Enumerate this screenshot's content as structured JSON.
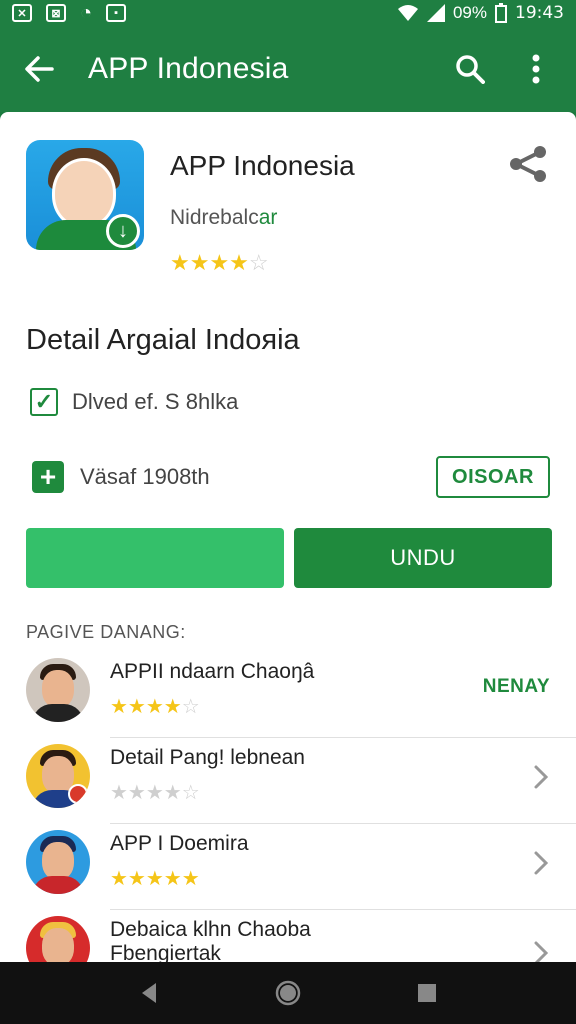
{
  "status_bar": {
    "battery": "09%",
    "time": "19:43"
  },
  "app_bar": {
    "title": "APP Indonesia"
  },
  "app": {
    "name": "APP Indonesia",
    "developer_prefix": "Nidrebalc",
    "developer_suffix": "ar",
    "rating": 3.5,
    "stars": "★★★★☆"
  },
  "detail": {
    "title": "Detail Argaial Indoяia",
    "checkbox_label": "Dlved ef. S 8hlka",
    "checkbox_checked": true,
    "version_label": "Väsaf 1908th",
    "outline_button": "OISOAR"
  },
  "buttons": {
    "primary_label": "UNDU"
  },
  "section": {
    "title": "PAGIVE DANANG:"
  },
  "list": [
    {
      "title": "APPII ndaarn Chaoŋâ",
      "rating": 4,
      "action": "NENAY"
    },
    {
      "title": "Detail Pang! lebnean",
      "rating": 4
    },
    {
      "title": "APP I Doemira",
      "rating": 4.5
    },
    {
      "title": "Debaica klhn Chaoba",
      "subtitle": "Fbengiertak"
    }
  ],
  "colors": {
    "primary": "#1f8a3d",
    "accent_light": "#34c06a",
    "star": "#f5c518"
  }
}
